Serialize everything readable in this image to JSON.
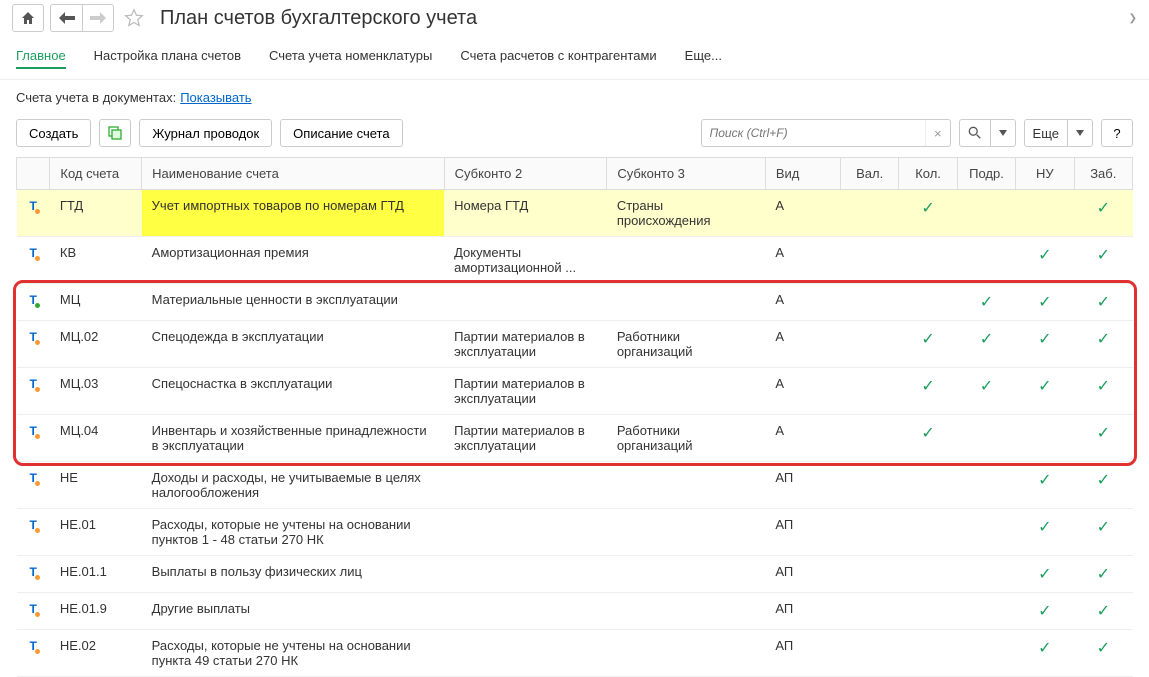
{
  "header": {
    "title": "План счетов бухгалтерского учета"
  },
  "tabs": [
    {
      "label": "Главное",
      "active": true
    },
    {
      "label": "Настройка плана счетов",
      "active": false
    },
    {
      "label": "Счета учета номенклатуры",
      "active": false
    },
    {
      "label": "Счета расчетов с контрагентами",
      "active": false
    },
    {
      "label": "Еще...",
      "active": false
    }
  ],
  "subbar": {
    "label": "Счета учета в документах:",
    "link": "Показывать"
  },
  "toolbar": {
    "create": "Создать",
    "journal": "Журнал проводок",
    "description": "Описание счета",
    "search_placeholder": "Поиск (Ctrl+F)",
    "more": "Еще"
  },
  "columns": {
    "code": "Код счета",
    "name": "Наименование счета",
    "sub2": "Субконто 2",
    "sub3": "Субконто 3",
    "vid": "Вид",
    "val": "Вал.",
    "kol": "Кол.",
    "podr": "Подр.",
    "nu": "НУ",
    "zab": "Заб."
  },
  "rows": [
    {
      "icon": "orange",
      "code": "ГТД",
      "name": "Учет импортных товаров по номерам ГТД",
      "sub2": "Номера ГТД",
      "sub3": "Страны происхождения",
      "vid": "А",
      "val": false,
      "kol": true,
      "podr": false,
      "nu": false,
      "zab": true,
      "hl": "sel"
    },
    {
      "icon": "orange",
      "code": "КВ",
      "name": "Амортизационная премия",
      "sub2": "Документы амортизационной ...",
      "sub3": "",
      "vid": "А",
      "val": false,
      "kol": false,
      "podr": false,
      "nu": true,
      "zab": true,
      "hl": ""
    },
    {
      "icon": "green",
      "code": "МЦ",
      "name": "Материальные ценности в эксплуатации",
      "sub2": "",
      "sub3": "",
      "vid": "А",
      "val": false,
      "kol": false,
      "podr": true,
      "nu": true,
      "zab": true,
      "hl": ""
    },
    {
      "icon": "orange",
      "code": "МЦ.02",
      "name": "Спецодежда в эксплуатации",
      "sub2": "Партии материалов в эксплуатации",
      "sub3": "Работники организаций",
      "vid": "А",
      "val": false,
      "kol": true,
      "podr": true,
      "nu": true,
      "zab": true,
      "hl": ""
    },
    {
      "icon": "orange",
      "code": "МЦ.03",
      "name": "Спецоснастка в эксплуатации",
      "sub2": "Партии материалов в эксплуатации",
      "sub3": "",
      "vid": "А",
      "val": false,
      "kol": true,
      "podr": true,
      "nu": true,
      "zab": true,
      "hl": ""
    },
    {
      "icon": "orange",
      "code": "МЦ.04",
      "name": "Инвентарь и хозяйственные принадлежности в эксплуатации",
      "sub2": "Партии материалов в эксплуатации",
      "sub3": "Работники организаций",
      "vid": "А",
      "val": false,
      "kol": true,
      "podr": false,
      "nu": false,
      "zab": true,
      "hl": ""
    },
    {
      "icon": "orange",
      "code": "НЕ",
      "name": "Доходы и расходы, не учитываемые в целях налогообложения",
      "sub2": "",
      "sub3": "",
      "vid": "АП",
      "val": false,
      "kol": false,
      "podr": false,
      "nu": true,
      "zab": true,
      "hl": ""
    },
    {
      "icon": "orange",
      "code": "НЕ.01",
      "name": "Расходы, которые не учтены на основании пунктов 1 - 48 статьи 270 НК",
      "sub2": "",
      "sub3": "",
      "vid": "АП",
      "val": false,
      "kol": false,
      "podr": false,
      "nu": true,
      "zab": true,
      "hl": ""
    },
    {
      "icon": "orange",
      "code": "НЕ.01.1",
      "name": "Выплаты в пользу физических лиц",
      "sub2": "",
      "sub3": "",
      "vid": "АП",
      "val": false,
      "kol": false,
      "podr": false,
      "nu": true,
      "zab": true,
      "hl": ""
    },
    {
      "icon": "orange",
      "code": "НЕ.01.9",
      "name": "Другие выплаты",
      "sub2": "",
      "sub3": "",
      "vid": "АП",
      "val": false,
      "kol": false,
      "podr": false,
      "nu": true,
      "zab": true,
      "hl": ""
    },
    {
      "icon": "orange",
      "code": "НЕ.02",
      "name": "Расходы, которые не учтены на основании пункта 49 статьи 270 НК",
      "sub2": "",
      "sub3": "",
      "vid": "АП",
      "val": false,
      "kol": false,
      "podr": false,
      "nu": true,
      "zab": true,
      "hl": ""
    }
  ]
}
